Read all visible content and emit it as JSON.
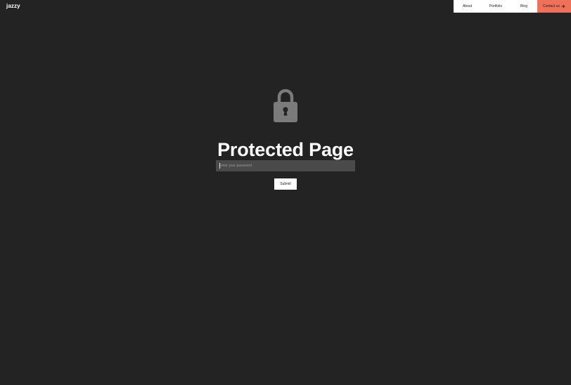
{
  "header": {
    "logo": "jazzy",
    "nav": [
      {
        "label": "About"
      },
      {
        "label": "Portfolio"
      },
      {
        "label": "Blog"
      }
    ],
    "cta_label": "Contact us",
    "cta_icon": "arrow-right-icon",
    "cta_color": "#f0715a"
  },
  "main": {
    "icon": "lock-icon",
    "title": "Protected Page",
    "password_placeholder": "Enter your password",
    "password_value": "",
    "submit_label": "Submit"
  }
}
